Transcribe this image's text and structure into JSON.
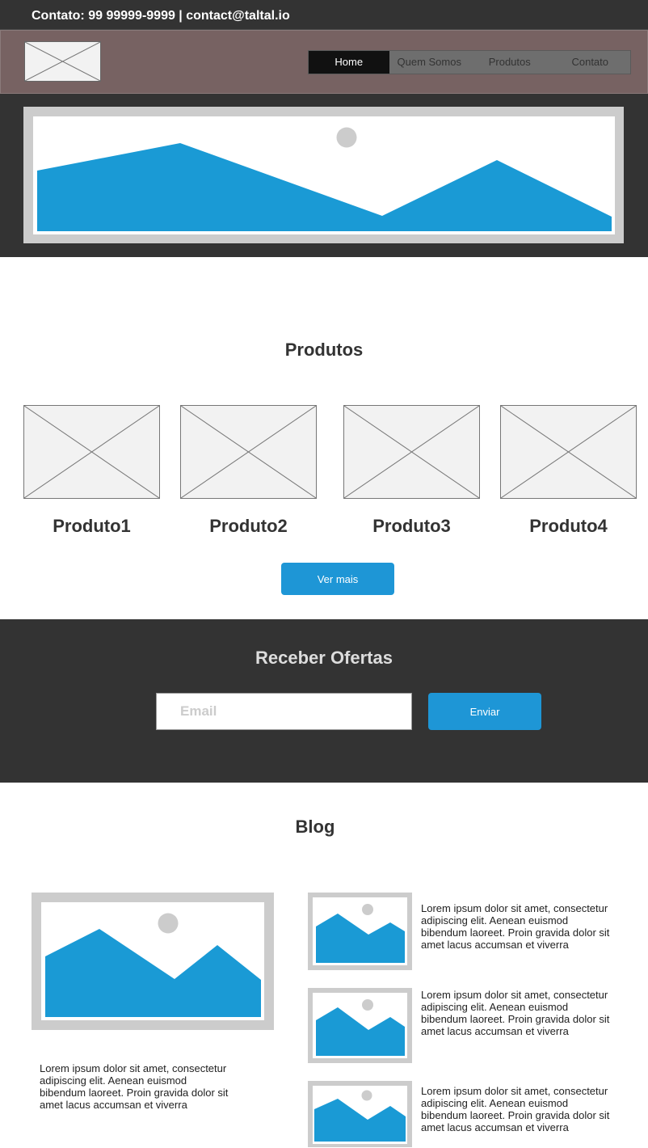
{
  "topbar": {
    "contact": "Contato: 99 99999-9999 | contact@taltal.io"
  },
  "nav": {
    "items": [
      "Home",
      "Quem Somos",
      "Produtos",
      "Contato"
    ],
    "active": "Home"
  },
  "produtos": {
    "title": "Produtos",
    "items": [
      "Produto1",
      "Produto2",
      "Produto3",
      "Produto4"
    ],
    "button": "Ver mais"
  },
  "ofertas": {
    "title": "Receber Ofertas",
    "email_placeholder": "Email",
    "email_value": "",
    "button": "Enviar"
  },
  "blog": {
    "title": "Blog",
    "main_text": "Lorem ipsum dolor sit amet, consectetur adipiscing elit. Aenean euismod bibendum laoreet. Proin gravida dolor sit amet lacus accumsan et viverra",
    "posts": [
      "Lorem ipsum dolor sit amet, consectetur adipiscing elit. Aenean euismod bibendum laoreet. Proin gravida dolor sit amet lacus accumsan et viverra",
      "Lorem ipsum dolor sit amet, consectetur adipiscing elit. Aenean euismod bibendum laoreet. Proin gravida dolor sit amet lacus accumsan et viverra",
      "Lorem ipsum dolor sit amet, consectetur adipiscing elit. Aenean euismod bibendum laoreet. Proin gravida dolor sit amet lacus accumsan et viverra"
    ]
  },
  "colors": {
    "accent": "#1e96d6",
    "dark": "#333333",
    "header": "#776262",
    "image_blue": "#1a9ad5",
    "placeholder_gray": "#cccccc"
  },
  "icons": [
    "logo-placeholder-icon",
    "image-placeholder-icon"
  ]
}
